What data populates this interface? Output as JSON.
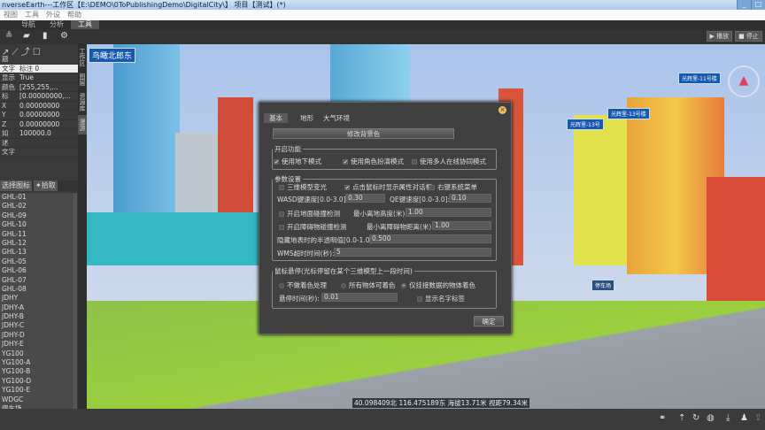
{
  "window": {
    "title": "nverseEarth---工作区【E:\\DEMO\\0ToPublishingDemo\\DigitalCity\\】     项目【测试】(*)",
    "min": "_",
    "restore": "□"
  },
  "menu": [
    "视图",
    "工具",
    "外设",
    "帮助"
  ],
  "tabs": [
    "导航",
    "分析",
    "工具"
  ],
  "playback": {
    "play": "▶ 播放",
    "stop": "■ 停止"
  },
  "properties": {
    "section1": "题",
    "rows": [
      {
        "k": "文字",
        "v": "标注 0"
      },
      {
        "k": "显示",
        "v": "True"
      },
      {
        "k": "颜色",
        "v": "[255,255,..."
      },
      {
        "k": "标",
        "v": "[0.00000000,..."
      },
      {
        "k": "X",
        "v": "0.00000000"
      },
      {
        "k": "Y",
        "v": "0.00000000"
      },
      {
        "k": "Z",
        "v": "0.00000000"
      },
      {
        "k": "如",
        "v": "100000.0"
      },
      {
        "k": "述",
        "v": ""
      },
      {
        "k": "文字",
        "v": ""
      }
    ]
  },
  "vertical_tabs": [
    "工作区",
    "图层",
    "资源库",
    "漫游"
  ],
  "list_toolbar": {
    "select": "选择图标",
    "pick": "拾取"
  },
  "list_items": [
    "GHL-01",
    "GHL-02",
    "GHL-09",
    "GHL-10",
    "GHL-11",
    "GHL-12",
    "GHL-13",
    "GHL-05",
    "GHL-06",
    "GHL-07",
    "GHL-08",
    "JDHY",
    "JDHY-A",
    "JDHY-B",
    "JDHY-C",
    "JDHY-D",
    "JDHY-E",
    "YG100",
    "YG100-A",
    "YG100-B",
    "YG100-D",
    "YG100-E",
    "WDGC",
    "停车场"
  ],
  "scene": {
    "place_label": "鸟瞰北郎东",
    "building_labels": [
      "光辉里-11号楼",
      "光辉里-13号楼",
      "光辉里-13号"
    ],
    "parking": "停车场",
    "coords": "40.098409北 116.475189东 海拔13.71米 视距79.34米"
  },
  "dialog": {
    "tabs": [
      "基本",
      "地形",
      "大气环境"
    ],
    "bg_button": "修改背景色",
    "g1": {
      "title": "开启功能",
      "c1": "使用地下模式",
      "c2": "使用角色扮演模式",
      "c3": "使用多人在线协同模式"
    },
    "g2": {
      "title": "参数设置",
      "c1": "三维模型变光",
      "c2": "点击鼠标时显示属性对话框",
      "c3": "右键系统菜单",
      "wasd_label": "WASD键速度[0.0-3.0]:",
      "wasd": "0.30",
      "qe_label": "QE键速度[0.0-3.0]:",
      "qe": "0.10",
      "c4": "开启地面碰撞检测",
      "minh_label": "最小离地高度(米):",
      "minh": "1.00",
      "c5": "开启障碍物碰撞检测",
      "mind_label": "最小离障碍物距离(米):",
      "mind": "1.00",
      "alpha_label": "隐藏地表时的半透明值[0.0-1.0]:",
      "alpha": "0.500",
      "wms_label": "WMS超时时间(秒):",
      "wms": "5"
    },
    "g3": {
      "title": "鼠标悬停(光标停留在某个三维模型上一段时间)",
      "r1": "不做着色处理",
      "r2": "所有物体可着色",
      "r3": "仅挂接数据的物体着色",
      "delay_label": "悬停时间(秒):",
      "delay": "0.01",
      "c1": "显示名字标签"
    },
    "ok": "确定",
    "checked": {
      "g1c1": true,
      "g1c2": true,
      "g1c3": false,
      "g2c1": false,
      "g2c2": true,
      "g2c3": false,
      "g2c4": false,
      "g2c5": false,
      "g3c1": false
    },
    "radio_selected": "r3"
  }
}
